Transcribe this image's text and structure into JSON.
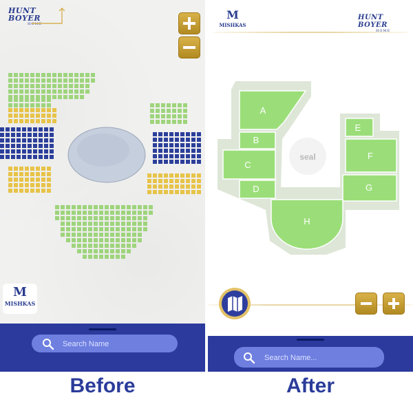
{
  "before": {
    "brand_logo": {
      "line1": "HUNT BOYER",
      "line2": "HOME"
    },
    "partner_logo": {
      "text": "MISHKAS",
      "monogram": "M"
    },
    "zoom_in_icon": "plus-icon",
    "zoom_out_icon": "minus-icon",
    "search": {
      "placeholder": "Search Name",
      "icon": "search-icon"
    },
    "caption": "Before",
    "colors": {
      "green": "#9ed47c",
      "yellow": "#e7c347",
      "blue": "#2c3f9a",
      "bar": "#2b3a9c"
    }
  },
  "after": {
    "partner_logo": {
      "text": "MISHKAS",
      "monogram": "M"
    },
    "brand_logo": {
      "line1": "HUNT BOYER",
      "line2": "HOME"
    },
    "map": {
      "center_label": "seal",
      "sections": [
        "A",
        "B",
        "C",
        "D",
        "E",
        "F",
        "G",
        "H"
      ]
    },
    "map_button_icon": "map-icon",
    "zoom_out_icon": "minus-icon",
    "zoom_in_icon": "plus-icon",
    "search": {
      "placeholder": "Search Name...",
      "icon": "search-icon"
    },
    "caption": "After",
    "colors": {
      "section_fill": "#9bde79",
      "section_stroke": "#ffffff",
      "venue_bg": "#dde6d7",
      "bar": "#2b3a9c"
    }
  }
}
